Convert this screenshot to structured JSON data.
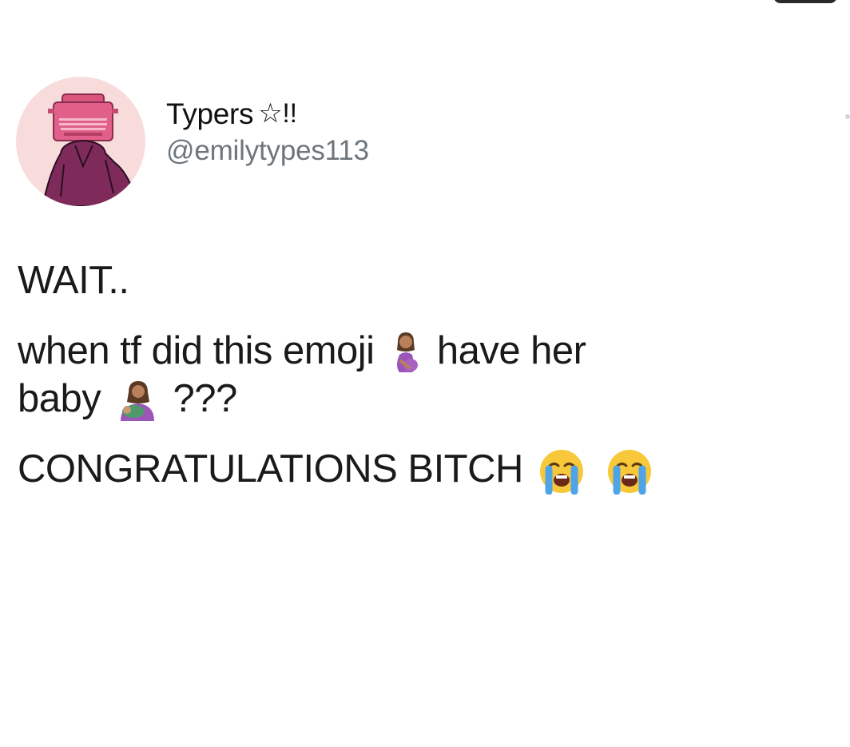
{
  "tweet": {
    "author": {
      "display_name": "Typers",
      "name_suffix": "☆!!",
      "handle": "@emilytypes113",
      "avatar_icon": "typewriter-head-avatar-icon"
    },
    "lines": {
      "line1": "WAIT..",
      "line2_a": "when tf did this emoji",
      "line2_b": "have her",
      "line3_a": "baby",
      "line3_b": "???",
      "line4_a": "CONGRATULATIONS BITCH"
    },
    "emojis": {
      "pregnant_woman": "pregnant-woman-emoji-icon",
      "breastfeeding": "breastfeeding-emoji-icon",
      "crying_face": "loudly-crying-face-emoji-icon"
    }
  }
}
